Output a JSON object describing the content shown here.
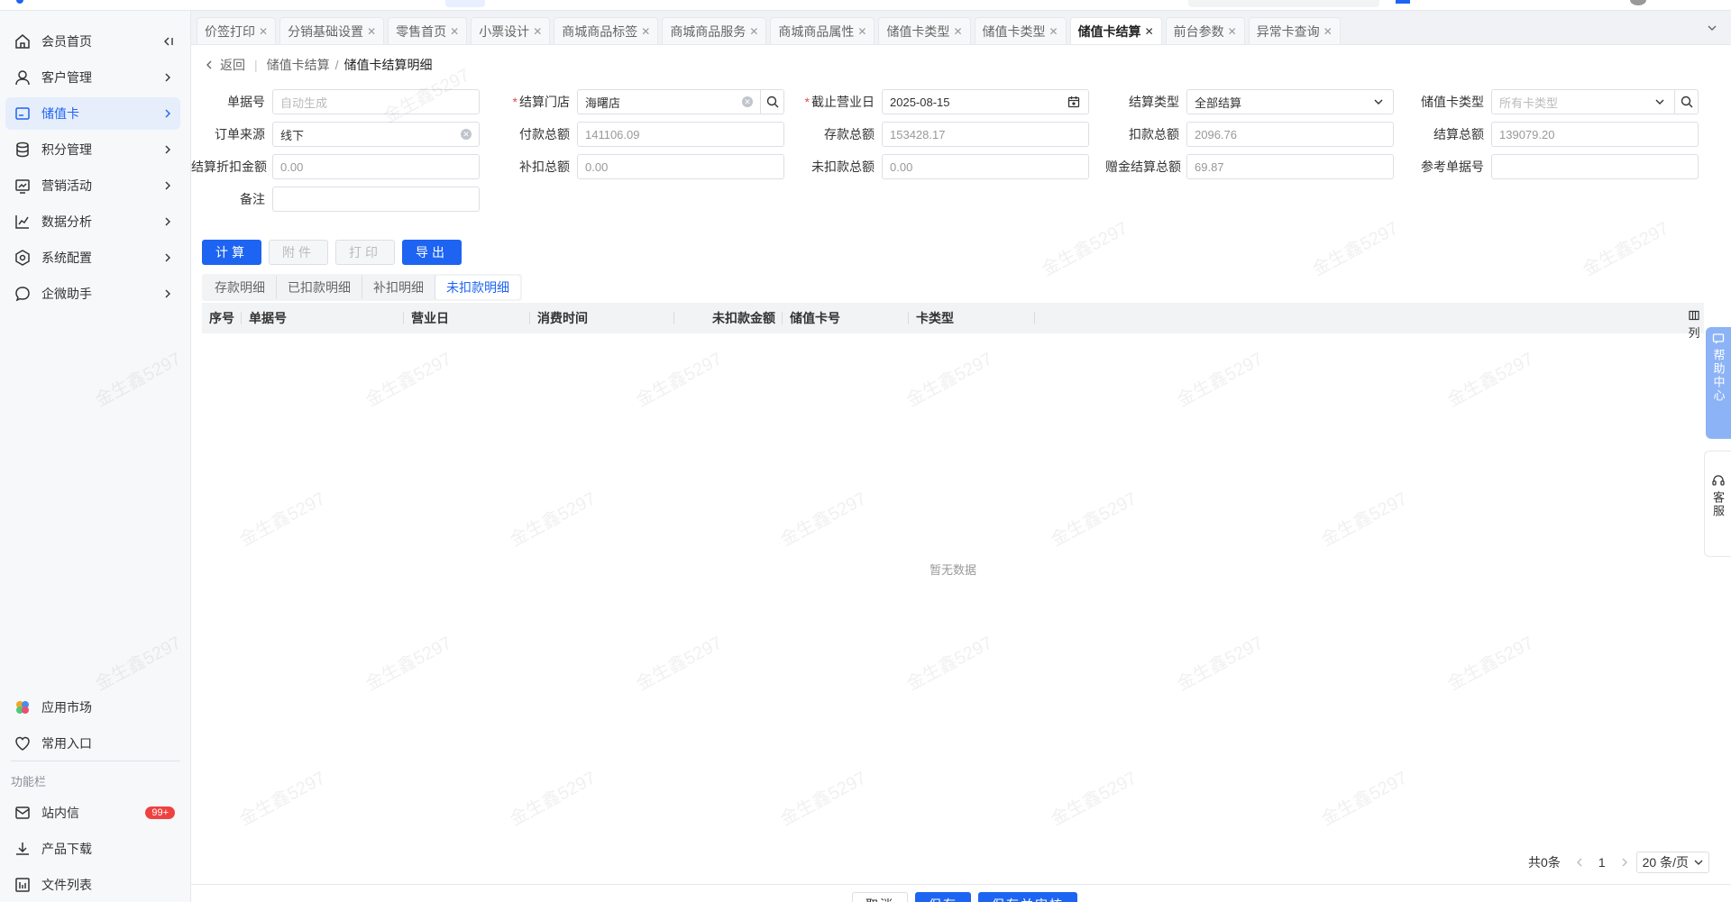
{
  "sidebar": {
    "collapse_icon": "collapse-left-icon",
    "items": [
      {
        "label": "会员首页",
        "icon": "home-icon"
      },
      {
        "label": "客户管理",
        "icon": "user-icon"
      },
      {
        "label": "储值卡",
        "icon": "card-icon"
      },
      {
        "label": "积分管理",
        "icon": "database-icon"
      },
      {
        "label": "营销活动",
        "icon": "campaign-icon"
      },
      {
        "label": "数据分析",
        "icon": "chart-icon"
      },
      {
        "label": "系统配置",
        "icon": "settings-icon"
      },
      {
        "label": "企微助手",
        "icon": "chat-icon"
      }
    ],
    "bottom_items": [
      {
        "label": "应用市场",
        "icon": "app-market-icon"
      },
      {
        "label": "常用入口",
        "icon": "heart-icon"
      }
    ],
    "section_label": "功能栏",
    "func_items": [
      {
        "label": "站内信",
        "icon": "mail-icon",
        "badge": "99+"
      },
      {
        "label": "产品下载",
        "icon": "download-icon"
      },
      {
        "label": "文件列表",
        "icon": "file-list-icon"
      }
    ]
  },
  "tabs": [
    {
      "label": "价签打印"
    },
    {
      "label": "分销基础设置"
    },
    {
      "label": "零售首页"
    },
    {
      "label": "小票设计"
    },
    {
      "label": "商城商品标签"
    },
    {
      "label": "商城商品服务"
    },
    {
      "label": "商城商品属性"
    },
    {
      "label": "储值卡类型"
    },
    {
      "label": "储值卡类型"
    },
    {
      "label": "储值卡结算"
    },
    {
      "label": "前台参数"
    },
    {
      "label": "异常卡查询"
    }
  ],
  "breadcrumb": {
    "back": "返回",
    "parent": "储值卡结算",
    "slash": "/",
    "current": "储值卡结算明细"
  },
  "form": {
    "row1": [
      {
        "label": "单据号",
        "placeholder": "自动生成",
        "value": ""
      },
      {
        "label": "结算门店",
        "required": "*",
        "value": "海曙店"
      },
      {
        "label": "截止营业日",
        "required": "*",
        "value": "2025-08-15"
      },
      {
        "label": "结算类型",
        "value": "全部结算"
      },
      {
        "label": "储值卡类型",
        "placeholder": "所有卡类型",
        "value": ""
      }
    ],
    "row2": [
      {
        "label": "订单来源",
        "value": "线下"
      },
      {
        "label": "付款总额",
        "value": "141106.09"
      },
      {
        "label": "存款总额",
        "value": "153428.17"
      },
      {
        "label": "扣款总额",
        "value": "2096.76"
      },
      {
        "label": "结算总额",
        "value": "139079.20"
      }
    ],
    "row3": [
      {
        "label": "结算折扣金额",
        "value": "0.00"
      },
      {
        "label": "补扣总额",
        "value": "0.00"
      },
      {
        "label": "未扣款总额",
        "value": "0.00"
      },
      {
        "label": "赠金结算总额",
        "value": "69.87"
      },
      {
        "label": "参考单据号",
        "value": ""
      }
    ],
    "row4": [
      {
        "label": "备注",
        "value": ""
      }
    ]
  },
  "actions": {
    "calc": "计算",
    "attach": "附件",
    "print": "打印",
    "export": "导出"
  },
  "subtabs": [
    {
      "label": "存款明细"
    },
    {
      "label": "已扣款明细"
    },
    {
      "label": "补扣明细"
    },
    {
      "label": "未扣款明细"
    }
  ],
  "table": {
    "columns": [
      "序号",
      "单据号",
      "营业日",
      "消费时间",
      "未扣款金额",
      "储值卡号",
      "卡类型"
    ],
    "empty_text": "暂无数据",
    "col_ctrl": "列"
  },
  "pagination": {
    "total": "共0条",
    "page": "1",
    "page_size": "20 条/页"
  },
  "footer": {
    "cancel": "取消",
    "save": "保存",
    "save_audit": "保存并审核"
  },
  "floats": {
    "help": "帮助中心",
    "service": "客服"
  },
  "watermark": "金生鑫5297",
  "colors": {
    "primary": "#1d64f2",
    "badge": "#f04141"
  }
}
